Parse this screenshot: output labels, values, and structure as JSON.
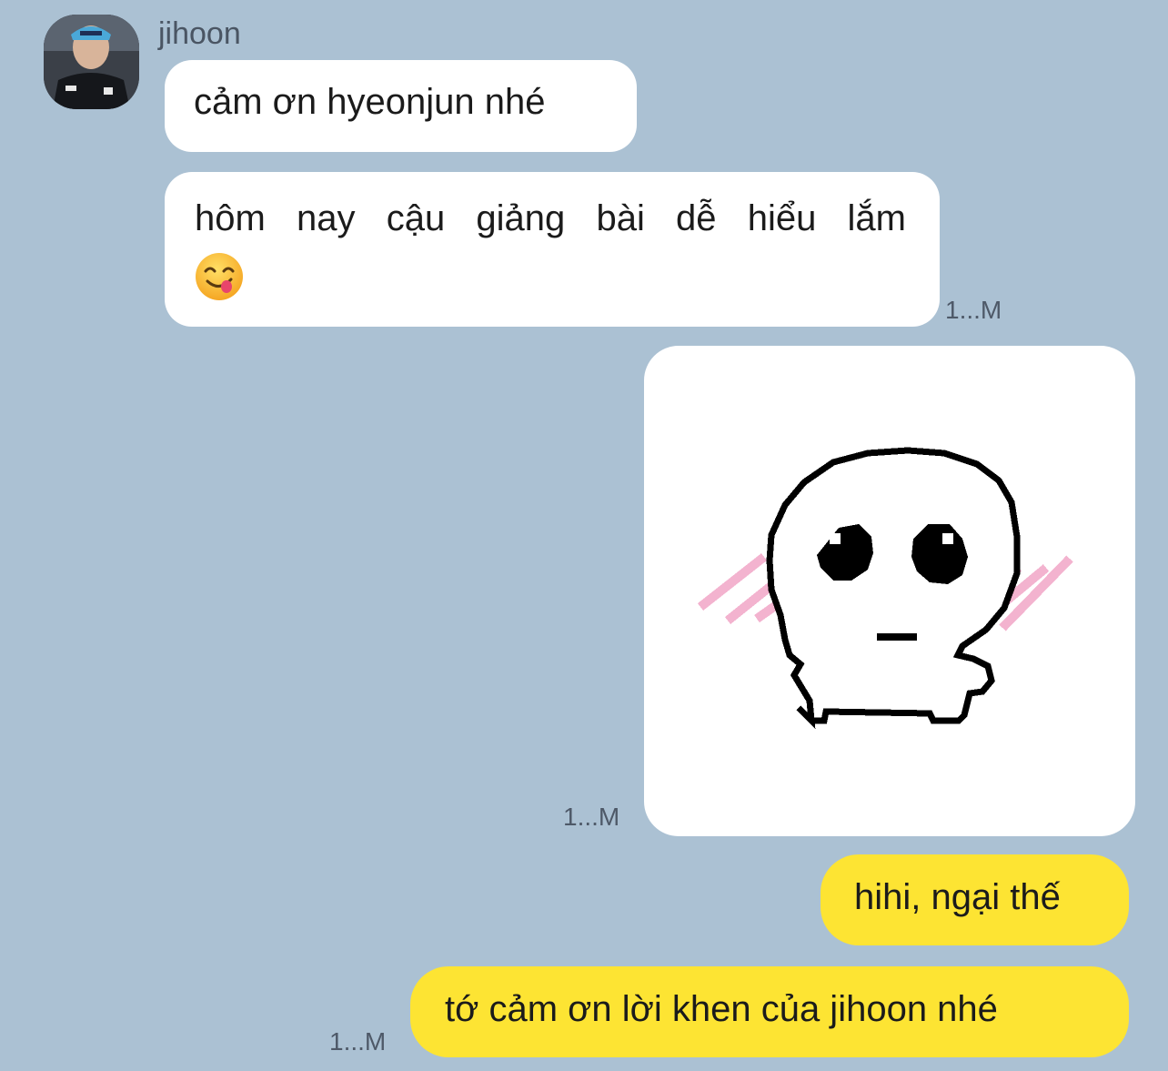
{
  "chat": {
    "sender_name": "jihoon",
    "avatar_icon": "profile-photo-avatar",
    "messages": [
      {
        "from": "jihoon",
        "type": "text",
        "text": "cảm ơn hyeonjun nhé"
      },
      {
        "from": "jihoon",
        "type": "text",
        "line1": "hôm nay cậu giảng bài dễ hiểu lắm",
        "emoji_icon": "face-savoring-food-icon",
        "time": "1...M"
      },
      {
        "from": "me",
        "type": "sticker",
        "sticker_icon": "pixel-ghost-blushing-sticker",
        "time": "1...M"
      },
      {
        "from": "me",
        "type": "text",
        "text": "hihi, ngại thế"
      },
      {
        "from": "me",
        "type": "text",
        "text": "tớ cảm ơn lời khen của jihoon nhé",
        "time": "1...M"
      }
    ]
  },
  "colors": {
    "background": "#abc1d3",
    "incoming_bubble": "#ffffff",
    "outgoing_bubble": "#fde433",
    "timestamp": "#4e5968"
  }
}
